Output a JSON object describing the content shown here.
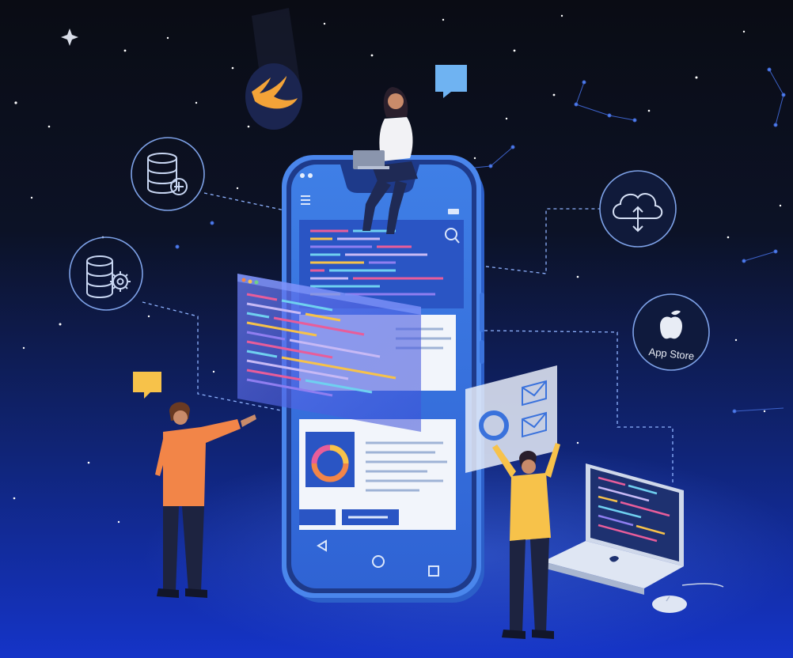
{
  "scene": {
    "badges": {
      "app_store": "App Store"
    },
    "icons": [
      "swift-icon",
      "database-icon",
      "database-settings-icon",
      "cloud-upload-icon",
      "apple-icon",
      "chat-bubble-icon",
      "mail-icon",
      "laptop",
      "mouse"
    ],
    "colors": {
      "background_top": "#0a0c14",
      "background_bottom": "#1534c8",
      "phone_frame": "#4a86ec",
      "swift_orange": "#f3a338",
      "accent_yellow": "#f7c24a",
      "shirt_orange": "#f28548"
    }
  }
}
